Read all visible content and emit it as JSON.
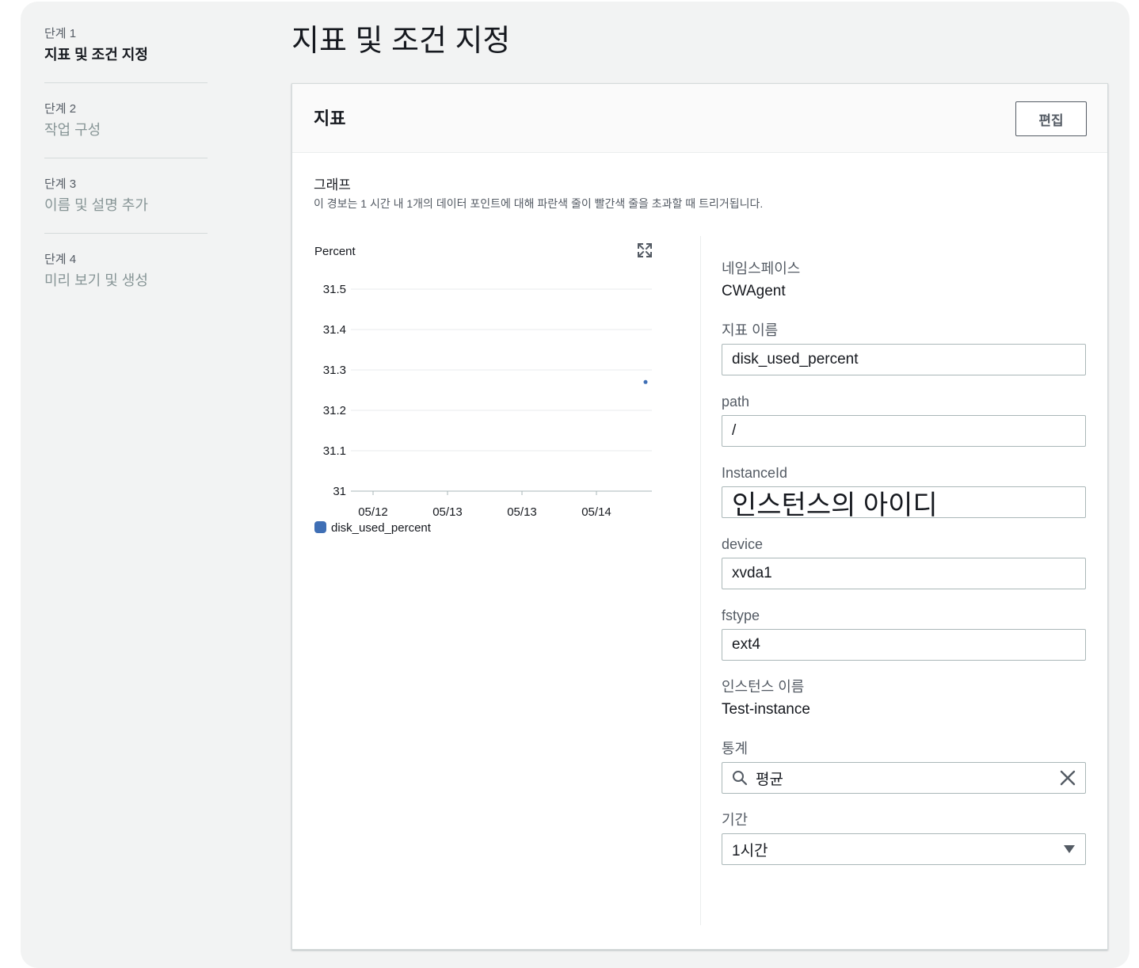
{
  "steps": [
    {
      "num": "단계 1",
      "title": "지표 및 조건 지정"
    },
    {
      "num": "단계 2",
      "title": "작업 구성"
    },
    {
      "num": "단계 3",
      "title": "이름 및 설명 추가"
    },
    {
      "num": "단계 4",
      "title": "미리 보기 및 생성"
    }
  ],
  "page_title": "지표 및 조건 지정",
  "panel": {
    "title": "지표",
    "edit_label": "편집",
    "graph_label": "그래프",
    "graph_desc": "이 경보는 1 시간 내 1개의 데이터 포인트에 대해 파란색 줄이 빨간색 줄을 초과할 때 트리거됩니다."
  },
  "chart_data": {
    "type": "scatter",
    "ylabel": "Percent",
    "ylim": [
      31,
      31.5
    ],
    "yticks": [
      "31.5",
      "31.4",
      "31.3",
      "31.2",
      "31.1",
      "31"
    ],
    "xticks": [
      "05/12",
      "05/13",
      "05/13",
      "05/14"
    ],
    "series": [
      {
        "name": "disk_used_percent",
        "color": "#3f6fb5",
        "points": [
          {
            "x": "05/14",
            "y": 31.27
          }
        ]
      }
    ],
    "legend": "bottom-left",
    "grid": true
  },
  "fields": {
    "namespace_label": "네임스페이스",
    "namespace_value": "CWAgent",
    "metric_label": "지표 이름",
    "metric_value": "disk_used_percent",
    "path_label": "path",
    "path_value": "/",
    "instanceid_label": "InstanceId",
    "instanceid_value": "인스턴스의 아이디",
    "device_label": "device",
    "device_value": "xvda1",
    "fstype_label": "fstype",
    "fstype_value": "ext4",
    "instancename_label": "인스턴스 이름",
    "instancename_value": "Test-instance",
    "stat_label": "통계",
    "stat_value": "평균",
    "period_label": "기간",
    "period_value": "1시간"
  }
}
